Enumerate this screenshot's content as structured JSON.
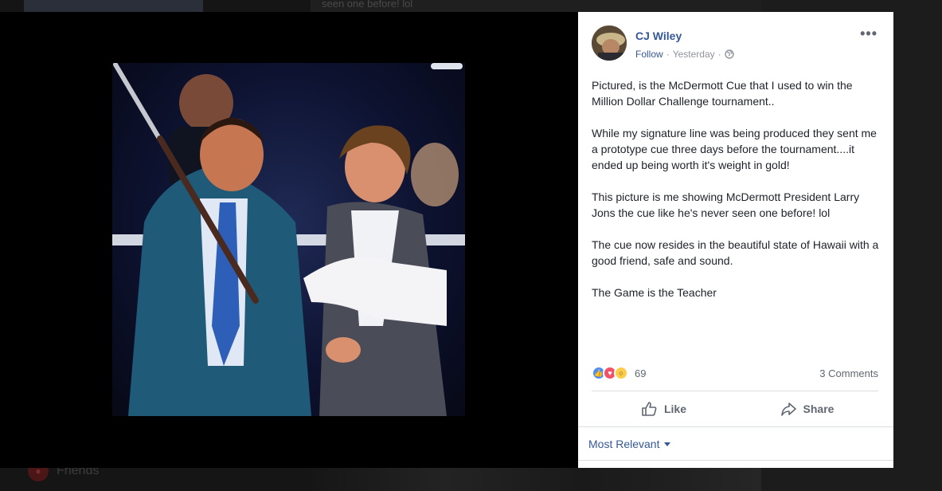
{
  "background": {
    "feed_snippet": "seen one before! lol",
    "sidebar_friends_label": "Friends"
  },
  "post": {
    "author": "CJ Wiley",
    "follow_label": "Follow",
    "separator": "·",
    "timestamp": "Yesterday",
    "privacy_icon": "globe-icon",
    "more_icon": "ellipsis-icon",
    "more_label": "•••",
    "paragraphs": [
      "Pictured, is the McDermott Cue that I used to win the Million Dollar Challenge tournament..",
      "While my signature line was being produced they sent me a prototype cue three days before the tournament....it ended up being worth it's weight in gold!",
      "This picture is me showing McDermott President Larry Jons the cue like he's never seen one before! lol",
      "The cue now resides in the beautiful state of Hawaii with a good friend, safe and sound.",
      "The Game is the Teacher"
    ],
    "reactions": {
      "icons": [
        "like-reaction-icon",
        "love-reaction-icon",
        "wow-reaction-icon"
      ],
      "count": "69"
    },
    "comments_count": "3 Comments",
    "actions": {
      "like_label": "Like",
      "share_label": "Share"
    },
    "sort_label": "Most Relevant"
  },
  "colors": {
    "link_blue": "#365899",
    "like_blue": "#4e8ef7",
    "love_red": "#f25268",
    "wow_yellow": "#fbcd4a",
    "text_dark": "#1d2129",
    "text_gray": "#606770"
  }
}
